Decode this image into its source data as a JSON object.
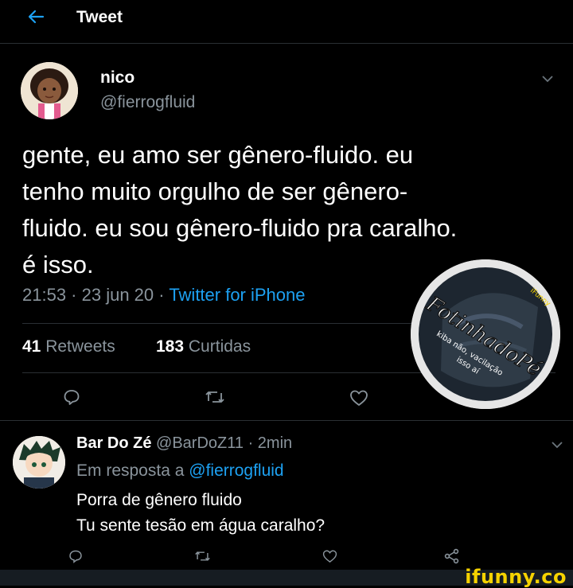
{
  "header": {
    "title": "Tweet"
  },
  "tweet": {
    "name": "nico",
    "handle": "@fierrogfluid",
    "text_lines": [
      "gente, eu amo ser gênero-fluido. eu",
      "tenho muito orgulho de ser gênero-",
      "fluido. eu sou gênero-fluido pra caralho.",
      "é isso."
    ],
    "time": "21:53",
    "date": "23 jun 20",
    "source": "Twitter for iPhone",
    "retweets_count": "41",
    "retweets_label": "Retweets",
    "likes_count": "183",
    "likes_label": "Curtidas"
  },
  "watermark": {
    "title": "FotinhadoPé",
    "caption_1": "kiba não, vacilação",
    "caption_2": "isso aí",
    "tag": "iFunny"
  },
  "reply": {
    "name": "Bar Do Zé",
    "handle": "@BarDoZ11",
    "time": "2min",
    "in_reply_prefix": "Em resposta a",
    "in_reply_handle": "@fierrogfluid",
    "line1": "Porra de gênero fluido",
    "line2": "Tu sente tesão em água caralho?"
  },
  "branding": {
    "logo": "ifunny.co"
  },
  "colors": {
    "background": "#000000",
    "accent": "#1da1f2",
    "muted": "#8a949c",
    "logo": "#f5d200"
  },
  "icons": [
    "back-arrow-icon",
    "chevron-down-icon",
    "reply-icon",
    "retweet-icon",
    "like-icon",
    "share-icon"
  ]
}
